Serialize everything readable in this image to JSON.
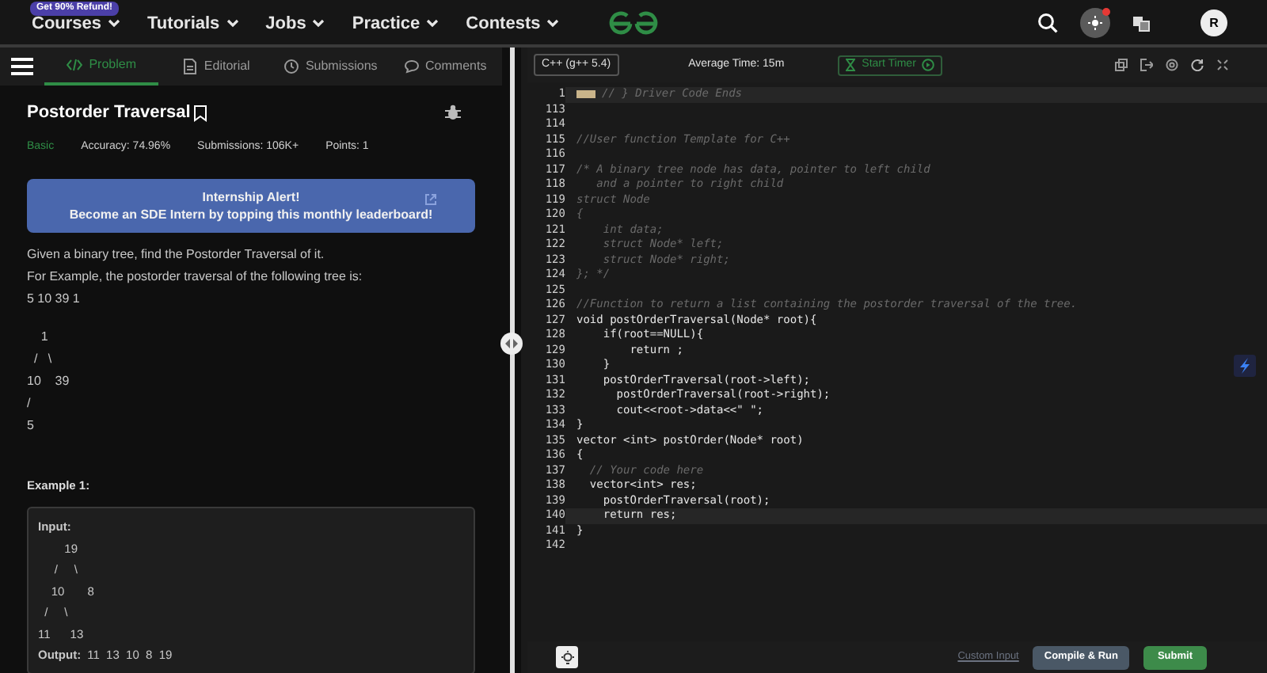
{
  "nav": {
    "badge": "Get 90% Refund!",
    "menus": [
      {
        "label": "Courses"
      },
      {
        "label": "Tutorials"
      },
      {
        "label": "Jobs"
      },
      {
        "label": "Practice"
      },
      {
        "label": "Contests"
      }
    ],
    "avatar": "R"
  },
  "tabs": [
    {
      "label": "Problem",
      "selected": true
    },
    {
      "label": "Editorial",
      "selected": false
    },
    {
      "label": "Submissions",
      "selected": false
    },
    {
      "label": "Comments",
      "selected": false
    }
  ],
  "problem": {
    "title": "Postorder Traversal",
    "difficulty": "Basic",
    "accuracy": "Accuracy: 74.96%",
    "submissions": "Submissions: 106K+",
    "points": "Points: 1",
    "banner": [
      "Internship Alert!",
      "Become an SDE Intern by topping this monthly leaderboard!"
    ],
    "description": [
      "Given a binary tree, find the Postorder Traversal of it.",
      "For Example, the postorder traversal of the following tree is:",
      "5 10 39 1"
    ],
    "tree": [
      "    1",
      "  /   \\",
      "10    39",
      "/",
      "5"
    ],
    "example_title": "Example 1:",
    "example": {
      "input_label": "Input:",
      "tree": [
        "        19",
        "     /     \\",
        "    10       8",
        "  /     \\",
        "11      13"
      ],
      "output_label": "Output:",
      "output": "11  13  10  8  19"
    }
  },
  "editor": {
    "language": "C++ (g++ 5.4)",
    "average_time": "Average Time: 15m",
    "timer": "Start Timer",
    "lines": [
      {
        "number": "1",
        "kind": "folded",
        "text": "// } Driver Code Ends",
        "active": true
      },
      {
        "number": "113",
        "kind": "code",
        "active": false
      },
      {
        "number": "114",
        "kind": "code",
        "active": false
      },
      {
        "number": "115",
        "kind": "comment",
        "text": "//User function Template for C++",
        "active": false
      },
      {
        "number": "116",
        "kind": "code",
        "active": false
      },
      {
        "number": "117",
        "kind": "comment",
        "text": "/* A binary tree node has data, pointer to left child",
        "active": false
      },
      {
        "number": "118",
        "kind": "comment",
        "text": "   and a pointer to right child",
        "active": false
      },
      {
        "number": "119",
        "kind": "comment",
        "text": "struct Node",
        "active": false
      },
      {
        "number": "120",
        "kind": "comment",
        "text": "{",
        "active": false
      },
      {
        "number": "121",
        "kind": "comment",
        "text": "    int data;",
        "active": false
      },
      {
        "number": "122",
        "kind": "comment",
        "text": "    struct Node* left;",
        "active": false
      },
      {
        "number": "123",
        "kind": "comment",
        "text": "    struct Node* right;",
        "active": false
      },
      {
        "number": "124",
        "kind": "comment",
        "text": "}; */",
        "active": false
      },
      {
        "number": "125",
        "kind": "code",
        "active": false
      },
      {
        "number": "126",
        "kind": "comment",
        "text": "//Function to return a list containing the postorder traversal of the tree.",
        "active": false
      },
      {
        "number": "127",
        "kind": "code",
        "text": "void postOrderTraversal(Node* root){",
        "active": false
      },
      {
        "number": "128",
        "kind": "code",
        "text": "    if(root==NULL){",
        "active": false
      },
      {
        "number": "129",
        "kind": "code",
        "text": "        return ;",
        "active": false
      },
      {
        "number": "130",
        "kind": "code",
        "text": "    }",
        "active": false
      },
      {
        "number": "131",
        "kind": "code",
        "text": "    postOrderTraversal(root->left);",
        "active": false
      },
      {
        "number": "132",
        "kind": "code",
        "text": "      postOrderTraversal(root->right);",
        "active": false
      },
      {
        "number": "133",
        "kind": "code",
        "text": "      cout<<root->data<<\" \";",
        "active": false
      },
      {
        "number": "134",
        "kind": "code",
        "text": "}",
        "active": false
      },
      {
        "number": "135",
        "kind": "code",
        "text": "vector <int> postOrder(Node* root)",
        "active": false
      },
      {
        "number": "136",
        "kind": "code",
        "text": "{",
        "active": false
      },
      {
        "number": "137",
        "kind": "comment",
        "text": "  // Your code here",
        "active": false
      },
      {
        "number": "138",
        "kind": "code",
        "text": "  vector<int> res;",
        "active": false
      },
      {
        "number": "139",
        "kind": "code",
        "text": "    postOrderTraversal(root);",
        "active": false
      },
      {
        "number": "140",
        "kind": "code",
        "text": "    return res;",
        "active": true
      },
      {
        "number": "141",
        "kind": "code",
        "text": "}",
        "active": false
      },
      {
        "number": "142",
        "kind": "code",
        "active": false
      }
    ],
    "custom_input": "Custom Input",
    "compile": "Compile & Run",
    "submit": "Submit"
  }
}
